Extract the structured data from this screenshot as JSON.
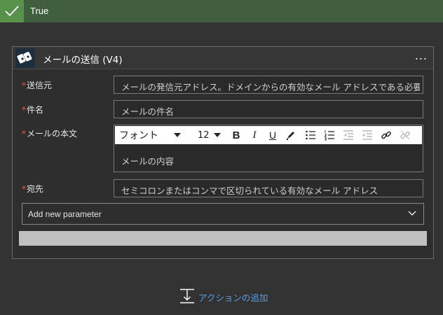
{
  "header": {
    "title": "True"
  },
  "action": {
    "title": "メールの送信 (V4)",
    "more_icon": "...",
    "fields": [
      {
        "label": "送信元",
        "required": "*",
        "placeholder": "メールの発信元アドレス。ドメインからの有効なメール アドレスである必要"
      },
      {
        "label": "件名",
        "required": "*",
        "placeholder": "メールの件名"
      },
      {
        "label": "メールの本文",
        "required": "*",
        "placeholder": "メールの内容"
      },
      {
        "label": "宛先",
        "required": "*",
        "placeholder": "セミコロンまたはコンマで区切られている有効なメール アドレス"
      }
    ],
    "toolbar": {
      "font": "フォント",
      "size": "12",
      "bold": "B",
      "italic": "I",
      "underline": "U"
    },
    "add_parameter": "Add new parameter"
  },
  "footer": {
    "add_action": "アクションの追加"
  },
  "colors": {
    "accent_green": "#57914a",
    "link_blue": "#5a9ee0",
    "required_red": "#f25757"
  }
}
